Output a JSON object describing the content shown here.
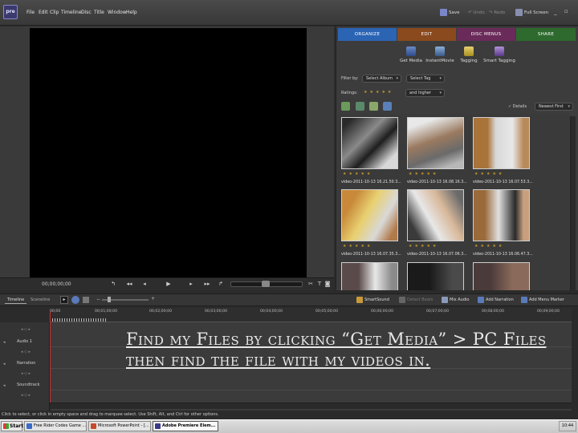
{
  "app": {
    "logo": "pre",
    "menu": [
      "File",
      "Edit",
      "Clip",
      "Timeline",
      "Disc",
      "Title",
      "Window",
      "Help"
    ],
    "toolbar": {
      "save": "Save",
      "undo": "Undo",
      "redo": "Redo",
      "full_screen": "Full Screen"
    }
  },
  "monitor": {
    "timecode": "00;00;00;00"
  },
  "organizer": {
    "tabs": [
      "ORGANIZE",
      "EDIT",
      "DISC MENUS",
      "SHARE"
    ],
    "tab_colors": [
      "#2c64b4",
      "#8a4a1e",
      "#6a2a5a",
      "#2e6a2e"
    ],
    "tools": [
      "Get Media",
      "InstantMovie",
      "Tagging",
      "Smart Tagging"
    ],
    "filter_label": "Filter by:",
    "filter_album": "Select Album",
    "filter_tag": "Select Tag",
    "ratings_label": "Ratings:",
    "ratings_filter": "and higher",
    "details_label": "Details",
    "sort": "Newest First",
    "clips": [
      {
        "name": "video-2011-10-13 16.21.50.3..."
      },
      {
        "name": "video-2011-10-13 16.08.16.3..."
      },
      {
        "name": "video-2011-10-13 16.07.53.3..."
      },
      {
        "name": "video-2011-10-13 16.07.35.3..."
      },
      {
        "name": "video-2011-10-13 16.07.06.3..."
      },
      {
        "name": "video-2011-10-13 16.06.47.3..."
      }
    ]
  },
  "timeline": {
    "tabs": [
      "Timeline",
      "Sceneline"
    ],
    "tools": {
      "smart_sound": "SmartSound",
      "detect_beats": "Detect Beats",
      "mix_audio": "Mix Audio",
      "add_narration": "Add Narration",
      "add_menu_marker": "Add Menu Marker"
    },
    "ruler": [
      "00;00",
      "00;01;00;00",
      "00;02;00;00",
      "00;03;00;00",
      "00;04;00;00",
      "00;05;00;00",
      "00;06;00;00",
      "00;07;00;00",
      "00;08;00;00",
      "00;09;00;00"
    ],
    "tracks": [
      "Audio 1",
      "Narration",
      "Soundtrack"
    ]
  },
  "overlay_text": "Find my Files by clicking “Get Media” >  PC Files then find the file with my videos in.",
  "status_text": "Click to select, or click in empty space and drag to marquee select. Use Shift, Alt, and Ctrl for other options.",
  "taskbar": {
    "start": "Start",
    "tasks": [
      "Free Rider Codes Game ...",
      "Microsoft PowerPoint - [...",
      "Adobe Premiere Elem..."
    ],
    "clock": "10:44"
  }
}
